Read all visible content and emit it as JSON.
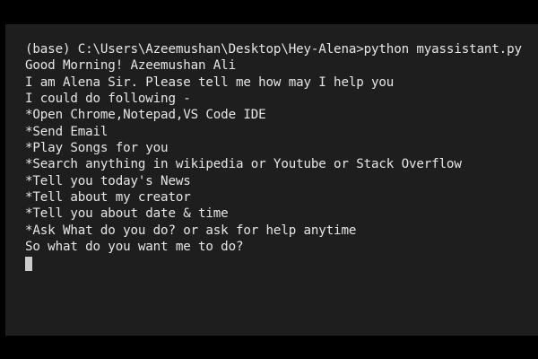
{
  "terminal": {
    "lines": [
      "(base) C:\\Users\\Azeemushan\\Desktop\\Hey-Alena>python myassistant.py",
      "Good Morning! Azeemushan Ali",
      "I am Alena Sir. Please tell me how may I help you",
      "I could do following -",
      "*Open Chrome,Notepad,VS Code IDE",
      "*Send Email",
      "*Play Songs for you",
      "*Search anything in wikipedia or Youtube or Stack Overflow",
      "*Tell you today's News",
      "*Tell about my creator",
      "*Tell you about date & time",
      "*Ask What do you do? or ask for help anytime",
      "So what do you want me to do?"
    ]
  },
  "colors": {
    "background": "#1e1e1e",
    "letterbox": "#000000",
    "text": "#e6e6e6",
    "cursor": "#cccccc"
  }
}
